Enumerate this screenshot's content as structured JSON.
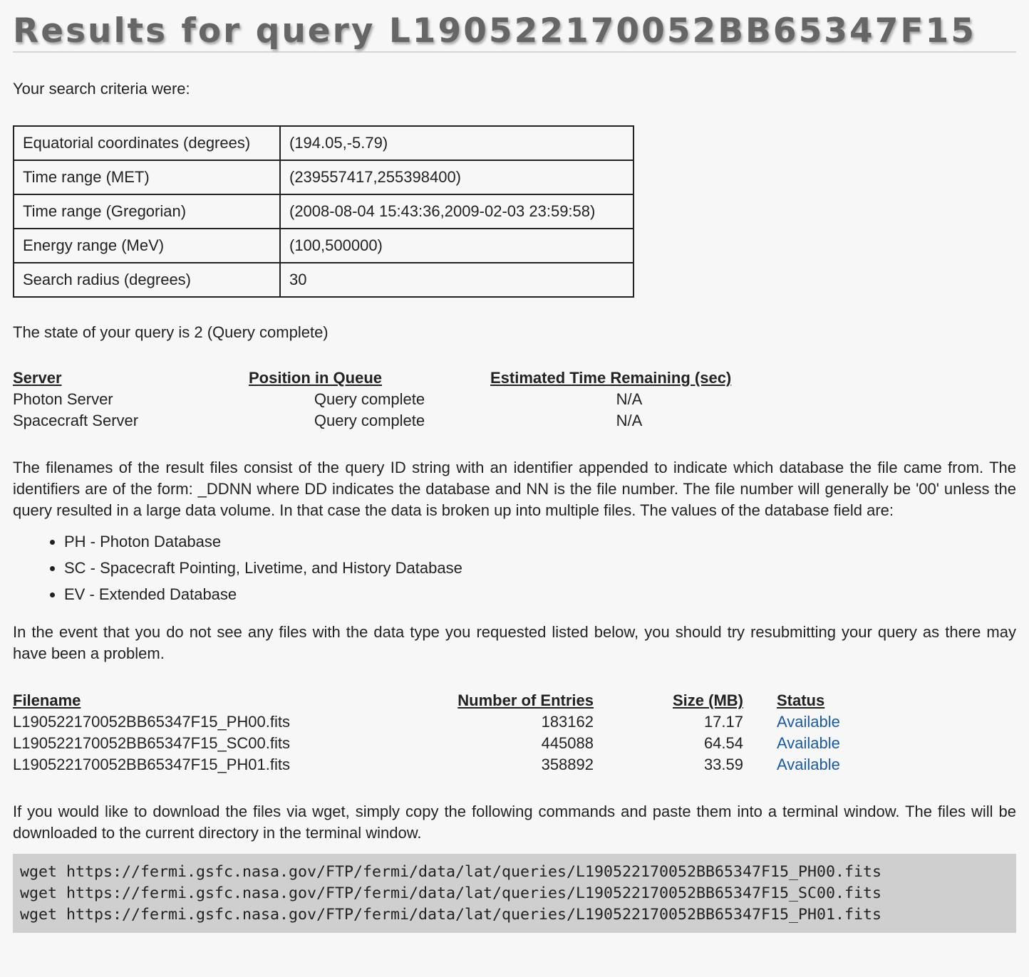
{
  "title": "Results for query L190522170052BB65347F15",
  "criteria_intro": "Your search criteria were:",
  "criteria": [
    {
      "key": "Equatorial coordinates (degrees)",
      "value": "(194.05,-5.79)"
    },
    {
      "key": "Time range (MET)",
      "value": "(239557417,255398400)"
    },
    {
      "key": "Time range (Gregorian)",
      "value": "(2008-08-04 15:43:36,2009-02-03 23:59:58)"
    },
    {
      "key": "Energy range (MeV)",
      "value": "(100,500000)"
    },
    {
      "key": "Search radius (degrees)",
      "value": "30"
    }
  ],
  "state_text": "The state of your query is 2 (Query complete)",
  "queue": {
    "headers": [
      "Server",
      "Position in Queue",
      "Estimated Time Remaining (sec)"
    ],
    "rows": [
      [
        "Photon Server",
        "Query complete",
        "N/A"
      ],
      [
        "Spacecraft Server",
        "Query complete",
        "N/A"
      ]
    ]
  },
  "explain_text": "The filenames of the result files consist of the query ID string with an identifier appended to indicate which database the file came from. The identifiers are of the form: _DDNN where DD indicates the database and NN is the file number. The file number will generally be '00' unless the query resulted in a large data volume. In that case the data is broken up into multiple files. The values of the database field are:",
  "databases": [
    "PH - Photon Database",
    "SC - Spacecraft Pointing, Livetime, and History Database",
    "EV - Extended Database"
  ],
  "event_text": "In the event that you do not see any files with the data type you requested listed below, you should try resubmitting your query as there may have been a problem.",
  "files": {
    "headers": [
      "Filename",
      "Number of Entries",
      "Size (MB)",
      "Status"
    ],
    "rows": [
      {
        "name": "L190522170052BB65347F15_PH00.fits",
        "entries": "183162",
        "size": "17.17",
        "status": "Available"
      },
      {
        "name": "L190522170052BB65347F15_SC00.fits",
        "entries": "445088",
        "size": "64.54",
        "status": "Available"
      },
      {
        "name": "L190522170052BB65347F15_PH01.fits",
        "entries": "358892",
        "size": "33.59",
        "status": "Available"
      }
    ]
  },
  "wget_intro": "If you would like to download the files via wget, simply copy the following commands and paste them into a terminal window. The files will be downloaded to the current directory in the terminal window.",
  "wget_commands": [
    "wget https://fermi.gsfc.nasa.gov/FTP/fermi/data/lat/queries/L190522170052BB65347F15_PH00.fits",
    "wget https://fermi.gsfc.nasa.gov/FTP/fermi/data/lat/queries/L190522170052BB65347F15_SC00.fits",
    "wget https://fermi.gsfc.nasa.gov/FTP/fermi/data/lat/queries/L190522170052BB65347F15_PH01.fits"
  ],
  "colors": {
    "link": "#1a5aa0",
    "code_bg": "#cfcfcf",
    "page_bg": "#f7f7f7"
  }
}
